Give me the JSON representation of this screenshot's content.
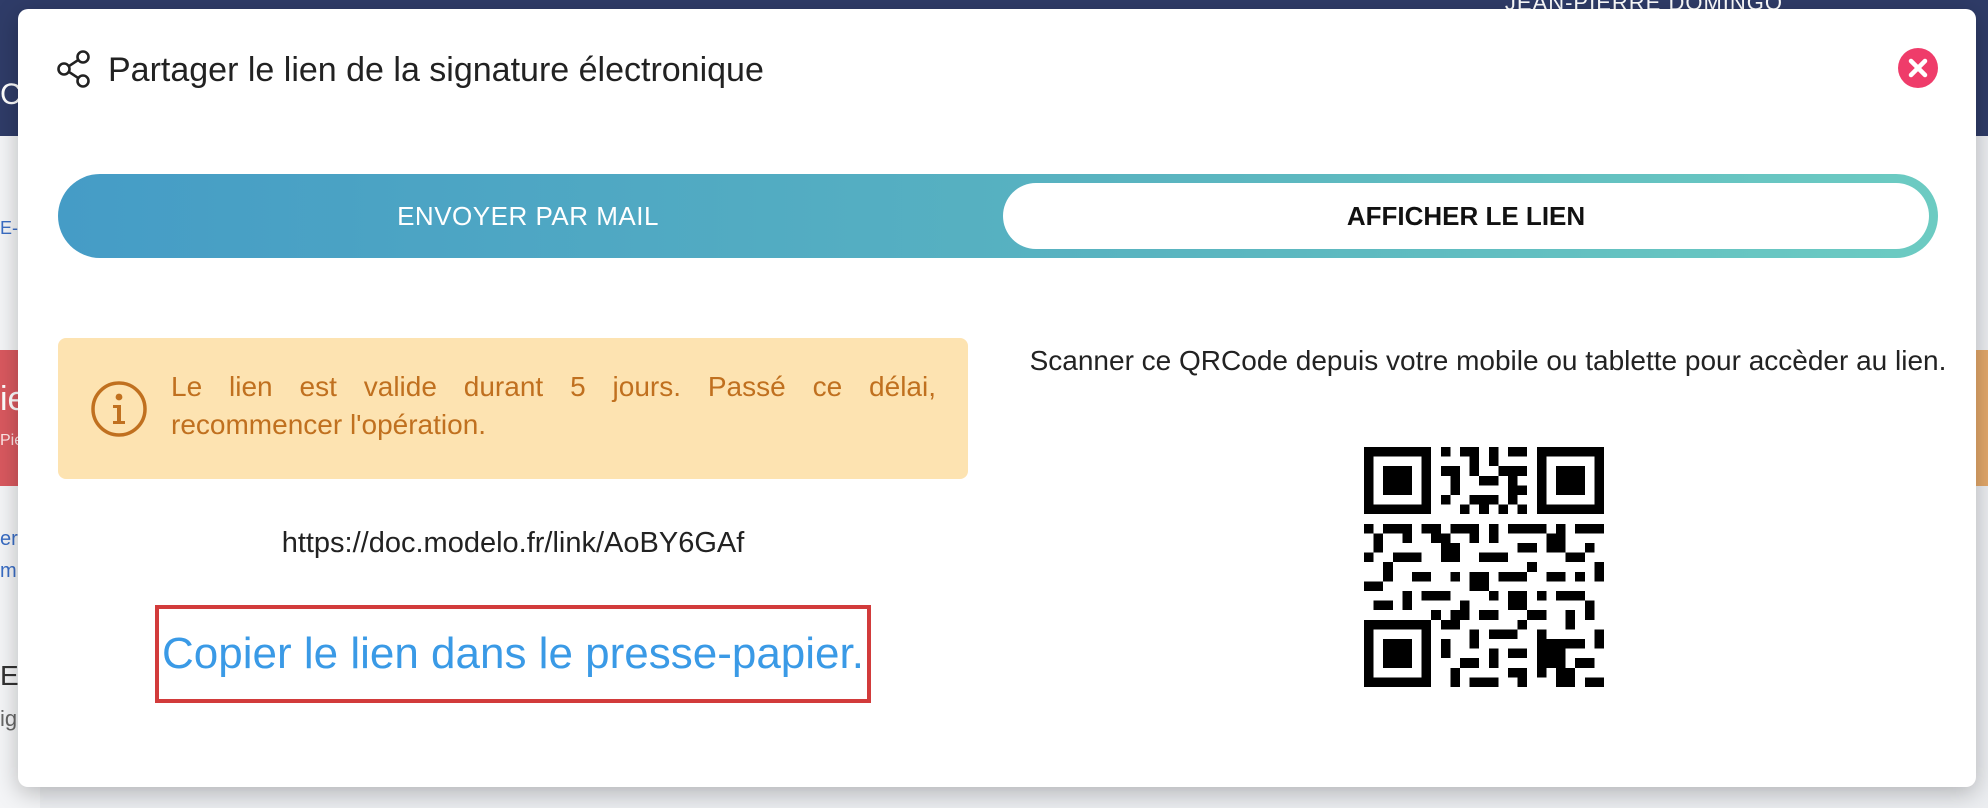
{
  "background": {
    "topbar_user": "JEAN-PIERRE DOMINGO",
    "fragments": [
      "Cu",
      "E-r",
      "ie",
      "Pie",
      "er",
      "m",
      "E",
      "ig"
    ]
  },
  "modal": {
    "title": "Partager le lien de la signature électronique",
    "title_icon": "share-icon",
    "close_icon": "close-icon",
    "tabs": [
      {
        "label": "ENVOYER PAR MAIL",
        "active": false
      },
      {
        "label": "AFFICHER LE LIEN",
        "active": true
      }
    ],
    "alert": {
      "icon": "info-icon",
      "text": "Le lien est valide durant 5 jours. Passé ce délai, recommencer l'opération."
    },
    "link_url": "https://doc.modelo.fr/link/AoBY6GAf",
    "copy_label": "Copier le lien dans le presse-papier.",
    "qr_instruction": "Scanner ce QRCode depuis votre mobile ou tablette pour accèder au lien."
  },
  "colors": {
    "accent_blue": "#3a9ae6",
    "close_red": "#ef3c6a",
    "alert_bg": "#fde3b1",
    "alert_text": "#c0701f",
    "highlight_border": "#d23b3b",
    "tab_gradient_start": "#459cc6",
    "tab_gradient_end": "#6ccbc2"
  }
}
